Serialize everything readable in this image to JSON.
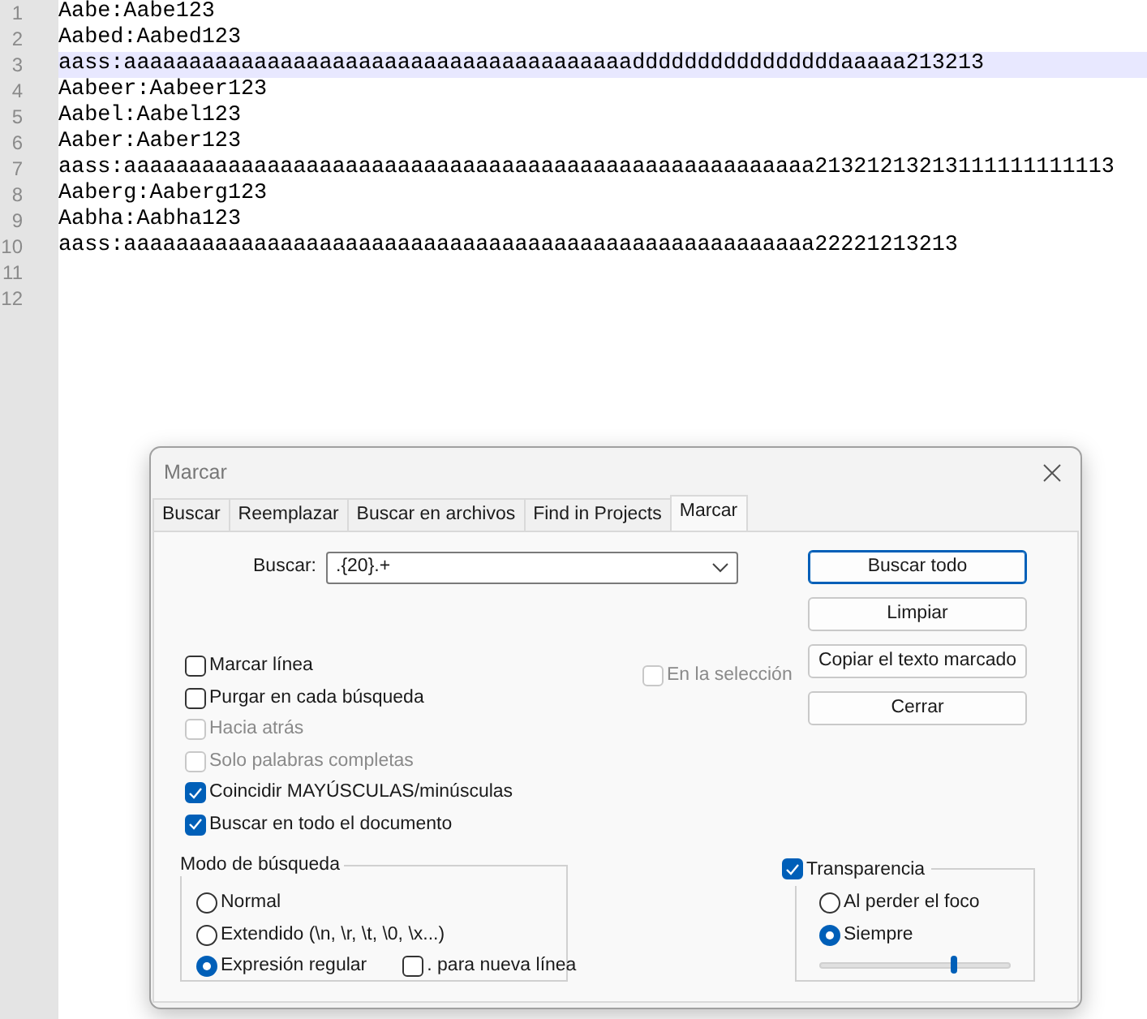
{
  "editor": {
    "lines": [
      {
        "number": "1",
        "text": "Aabe:Aabe123",
        "highlighted": false
      },
      {
        "number": "2",
        "text": "Aabed:Aabed123",
        "highlighted": false
      },
      {
        "number": "3",
        "text": "aass:aaaaaaaaaaaaaaaaaaaaaaaaaaaaaaaaaaaaaaaddddddddddddddddaaaaa213213",
        "highlighted": true
      },
      {
        "number": "4",
        "text": "Aabeer:Aabeer123",
        "highlighted": false
      },
      {
        "number": "5",
        "text": "Aabel:Aabel123",
        "highlighted": false
      },
      {
        "number": "6",
        "text": "Aaber:Aaber123",
        "highlighted": false
      },
      {
        "number": "7",
        "text": "aass:aaaaaaaaaaaaaaaaaaaaaaaaaaaaaaaaaaaaaaaaaaaaaaaaaaaaa21321213213111111111113",
        "highlighted": false
      },
      {
        "number": "8",
        "text": "Aaberg:Aaberg123",
        "highlighted": false
      },
      {
        "number": "9",
        "text": "Aabha:Aabha123",
        "highlighted": false
      },
      {
        "number": "10",
        "text": "aass:aaaaaaaaaaaaaaaaaaaaaaaaaaaaaaaaaaaaaaaaaaaaaaaaaaaaa22221213213",
        "highlighted": false
      },
      {
        "number": "11",
        "highlighted": false
      },
      {
        "number": "12",
        "highlighted": false
      }
    ]
  },
  "dialog": {
    "title": "Marcar",
    "tabs": [
      {
        "label": "Buscar",
        "selected": false
      },
      {
        "label": "Reemplazar",
        "selected": false
      },
      {
        "label": "Buscar en archivos",
        "selected": false
      },
      {
        "label": "Find in Projects",
        "selected": false
      },
      {
        "label": "Marcar",
        "selected": true
      }
    ],
    "search": {
      "label": "Buscar:",
      "value": ".{20}.+"
    },
    "buttons": [
      {
        "label": "Buscar todo",
        "default": true
      },
      {
        "label": "Limpiar",
        "default": false
      },
      {
        "label": "Copiar el texto marcado",
        "default": false
      },
      {
        "label": "Cerrar",
        "default": false
      }
    ],
    "in_selection": {
      "label": "En la selección",
      "checked": false,
      "disabled": true
    },
    "options": [
      {
        "label": "Marcar línea",
        "checked": false,
        "disabled": false
      },
      {
        "label": "Purgar en cada búsqueda",
        "checked": false,
        "disabled": false
      },
      {
        "label": "Hacia atrás",
        "checked": false,
        "disabled": true
      },
      {
        "label": "Solo palabras completas",
        "checked": false,
        "disabled": true
      },
      {
        "label": "Coincidir MAYÚSCULAS/minúsculas",
        "checked": true,
        "disabled": false
      },
      {
        "label": "Buscar en todo el documento",
        "checked": true,
        "disabled": false
      }
    ],
    "search_mode": {
      "title": "Modo de búsqueda",
      "options": [
        {
          "label": "Normal",
          "selected": false
        },
        {
          "label": "Extendido (\\n, \\r, \\t, \\0, \\x...)",
          "selected": false
        },
        {
          "label": "Expresión regular",
          "selected": true
        }
      ],
      "dot_newline": {
        "label": ". para nueva línea",
        "checked": false
      }
    },
    "transparency": {
      "label": "Transparencia",
      "checked": true,
      "options": [
        {
          "label": "Al perder el foco",
          "selected": false
        },
        {
          "label": "Siempre",
          "selected": true
        }
      ],
      "level": 0.7
    }
  }
}
